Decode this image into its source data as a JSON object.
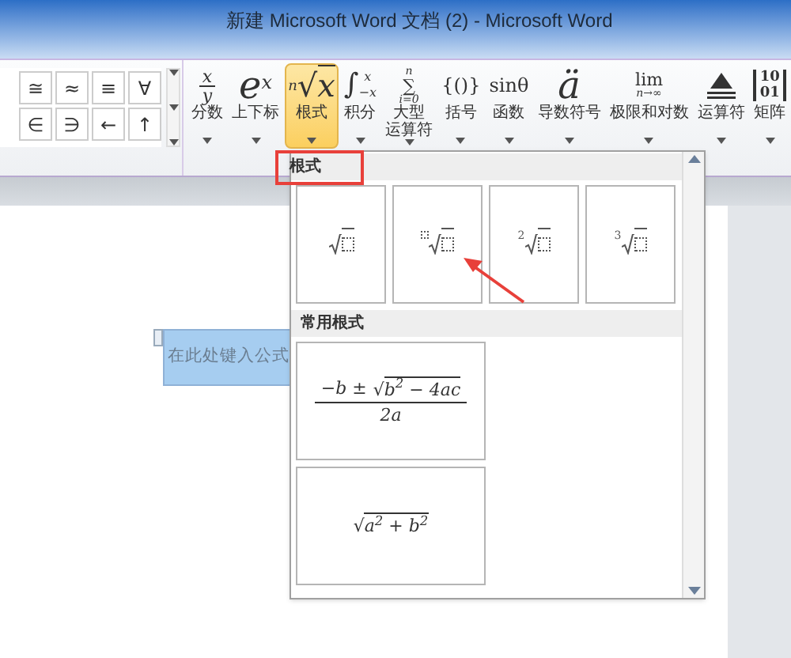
{
  "window": {
    "title": "新建 Microsoft Word 文档 (2) - Microsoft Word"
  },
  "symbol_gallery": {
    "rows": [
      [
        "≅",
        "≈",
        "≡",
        "∀"
      ],
      [
        "∈",
        "∋",
        "←",
        "↑"
      ]
    ]
  },
  "ribbon_buttons": [
    {
      "label": "分数",
      "selected": false,
      "glyph": {
        "kind": "fraction",
        "top": "x",
        "bottom": "y"
      }
    },
    {
      "label": "上下标",
      "selected": false,
      "glyph": {
        "kind": "script",
        "base": "e",
        "sup": "x"
      }
    },
    {
      "label": "根式",
      "selected": true,
      "glyph": {
        "kind": "radical",
        "index": "n",
        "sign": "√",
        "base": "x"
      }
    },
    {
      "label": "积分",
      "selected": false,
      "glyph": {
        "kind": "limits",
        "sign": "∫",
        "sup": "x",
        "sub": "−x"
      }
    },
    {
      "label": [
        "大型",
        "运算符"
      ],
      "selected": false,
      "glyph": {
        "kind": "stacked",
        "sign": "∑",
        "sup": "n",
        "sub": "i=0"
      }
    },
    {
      "label": "括号",
      "selected": false,
      "glyph": {
        "kind": "plain",
        "text": "{()}"
      }
    },
    {
      "label": "函数",
      "selected": false,
      "glyph": {
        "kind": "plain",
        "text": "sinθ"
      }
    },
    {
      "label": "导数符号",
      "selected": false,
      "glyph": {
        "kind": "big",
        "text": "ä"
      }
    },
    {
      "label": "极限和对数",
      "selected": false,
      "glyph": {
        "kind": "stacked",
        "sign": "lim",
        "sub": "n→∞"
      }
    },
    {
      "label": "运算符",
      "selected": false,
      "glyph": {
        "kind": "operator"
      }
    },
    {
      "label": "矩阵",
      "selected": false,
      "glyph": {
        "kind": "matrix",
        "rows": [
          "10",
          "01"
        ]
      }
    }
  ],
  "document": {
    "equation_placeholder": "在此处键入公式"
  },
  "dropdown": {
    "sections": [
      {
        "title": "根式",
        "highlighted": true,
        "tiles": [
          {
            "kind": "radical_template",
            "index_box": false
          },
          {
            "kind": "radical_template",
            "index_box": true
          },
          {
            "kind": "radical_template",
            "index": "2"
          },
          {
            "kind": "radical_template",
            "index": "3"
          }
        ]
      },
      {
        "title": "常用根式",
        "highlighted": false,
        "tiles": [
          {
            "kind": "formula_fraction",
            "prefix": "−b ±",
            "sign": "√",
            "radicand": "b$^{2}$ − 4ac",
            "denominator": "2a"
          },
          {
            "kind": "formula_radical",
            "sign": "√",
            "radicand": "a$^{2}$ + b$^{2}$"
          }
        ]
      }
    ]
  }
}
